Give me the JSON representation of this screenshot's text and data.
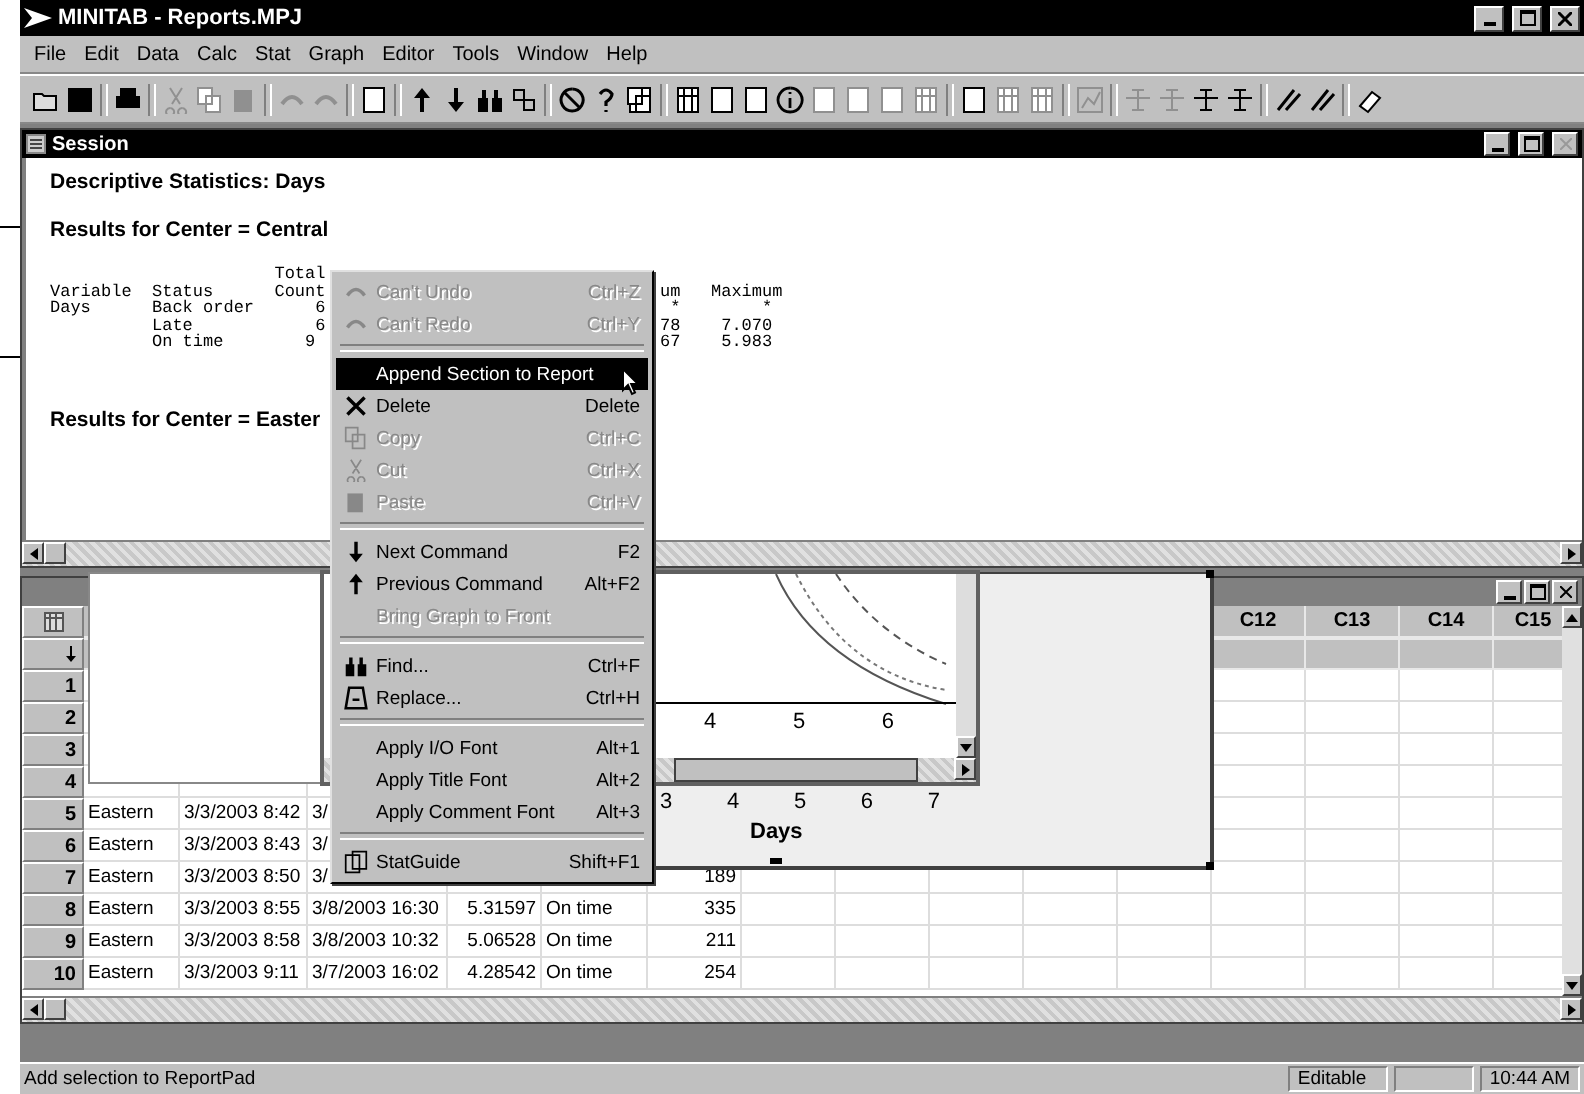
{
  "window": {
    "title": "MINITAB - Reports.MPJ"
  },
  "menu": [
    "File",
    "Edit",
    "Data",
    "Calc",
    "Stat",
    "Graph",
    "Editor",
    "Tools",
    "Window",
    "Help"
  ],
  "session": {
    "title": "Session",
    "heading": "Descriptive Statistics: Days",
    "sections": [
      "Results for Center = Central",
      "Results for Center = Easter"
    ],
    "output": [
      {
        "left": "                      Total"
      },
      {
        "left": "Variable  Status      Count",
        "right": "um   Maximum"
      },
      {
        "left": "Days      Back order      6",
        "right": " *        *"
      },
      {
        "left": "          Late            6",
        "right": "78    7.070"
      },
      {
        "left": "          On time        9",
        "right": "67    5.983"
      }
    ]
  },
  "context_menu": [
    {
      "kind": "item",
      "label": "Can't Undo",
      "shortcut": "Ctrl+Z",
      "disabled": true,
      "selected": false
    },
    {
      "kind": "item",
      "label": "Can't Redo",
      "shortcut": "Ctrl+Y",
      "disabled": true,
      "selected": false
    },
    {
      "kind": "separator"
    },
    {
      "kind": "item",
      "label": "Append Section to Report",
      "disabled": false,
      "selected": true
    },
    {
      "kind": "item",
      "label": "Delete",
      "shortcut": "Delete",
      "disabled": false,
      "selected": false
    },
    {
      "kind": "item",
      "label": "Copy",
      "shortcut": "Ctrl+C",
      "disabled": true,
      "selected": false
    },
    {
      "kind": "item",
      "label": "Cut",
      "shortcut": "Ctrl+X",
      "disabled": true,
      "selected": false
    },
    {
      "kind": "item",
      "label": "Paste",
      "shortcut": "Ctrl+V",
      "disabled": true,
      "selected": false
    },
    {
      "kind": "separator"
    },
    {
      "kind": "item",
      "label": "Next Command",
      "shortcut": "F2",
      "disabled": false,
      "selected": false
    },
    {
      "kind": "item",
      "label": "Previous Command",
      "shortcut": "Alt+F2",
      "disabled": false,
      "selected": false
    },
    {
      "kind": "item",
      "label": "Bring Graph to Front",
      "disabled": true,
      "selected": false
    },
    {
      "kind": "separator"
    },
    {
      "kind": "item",
      "label": "Find...",
      "shortcut": "Ctrl+F",
      "disabled": false,
      "selected": false
    },
    {
      "kind": "item",
      "label": "Replace...",
      "shortcut": "Ctrl+H",
      "disabled": false,
      "selected": false
    },
    {
      "kind": "separator"
    },
    {
      "kind": "item",
      "label": "Apply I/O Font",
      "shortcut": "Alt+1",
      "disabled": false,
      "selected": false
    },
    {
      "kind": "item",
      "label": "Apply Title Font",
      "shortcut": "Alt+2",
      "disabled": false,
      "selected": false
    },
    {
      "kind": "item",
      "label": "Apply Comment Font",
      "shortcut": "Alt+3",
      "disabled": false,
      "selected": false
    },
    {
      "kind": "separator"
    },
    {
      "kind": "item",
      "label": "StatGuide",
      "shortcut": "Shift+F1",
      "disabled": false,
      "selected": false
    }
  ],
  "graphs": {
    "back": {
      "ticks": [
        "3",
        "4",
        "5",
        "6",
        "7"
      ],
      "x_label": "Days"
    },
    "front": {
      "ticks": [
        "4",
        "5",
        "6"
      ]
    }
  },
  "worksheet": {
    "headers": [
      "C12",
      "C13",
      "C14",
      "C15"
    ],
    "rows": [
      {
        "number": "1",
        "cells": []
      },
      {
        "number": "2",
        "cells": []
      },
      {
        "number": "3",
        "cells": []
      },
      {
        "number": "4",
        "cells": []
      },
      {
        "number": "5",
        "cells": [
          "Eastern",
          "3/3/2003 8:42",
          "3/"
        ]
      },
      {
        "number": "6",
        "cells": [
          "Eastern",
          "3/3/2003 8:43",
          "3/"
        ]
      },
      {
        "number": "7",
        "cells": [
          "Eastern",
          "3/3/2003 8:50",
          "3/",
          null,
          null,
          "189"
        ]
      },
      {
        "number": "8",
        "cells": [
          "Eastern",
          "3/3/2003 8:55",
          "3/8/2003 16:30",
          "5.31597",
          "On time",
          "335"
        ]
      },
      {
        "number": "9",
        "cells": [
          "Eastern",
          "3/3/2003 8:58",
          "3/8/2003 10:32",
          "5.06528",
          "On time",
          "211"
        ]
      },
      {
        "number": "10",
        "cells": [
          "Eastern",
          "3/3/2003 9:11",
          "3/7/2003 16:02",
          "4.28542",
          "On time",
          "254"
        ]
      }
    ]
  },
  "status_bar": {
    "message": "Add selection to ReportPad",
    "panes": [
      "Editable",
      "10:44 AM"
    ]
  }
}
